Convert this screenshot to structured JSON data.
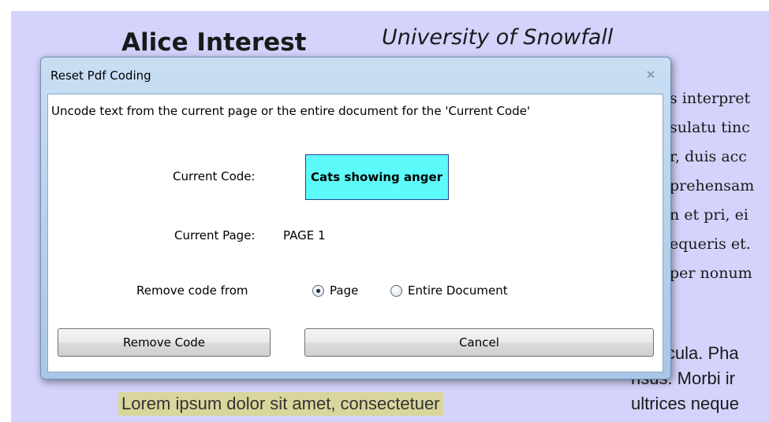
{
  "document": {
    "title": "Alice Interest",
    "affiliation": "University of Snowfall",
    "right_serif_lines": [
      "s interpret",
      "sulatu tinc",
      "r, duis acc",
      "prehensam",
      "n et pri, ei",
      "equeris et.",
      "per nonum"
    ],
    "right_sans_lines": [
      "icula. Pha",
      "risus. Morbi ir",
      "ultrices neque"
    ],
    "highlighted_line": "Lorem ipsum dolor sit amet, consectetuer",
    "highlight_color": "#d9d69c",
    "background_color": "#d4d3fb"
  },
  "dialog": {
    "title": "Reset Pdf Coding",
    "close_icon": "close-icon",
    "description": "Uncode text from the current page or the entire document for the 'Current Code'",
    "current_code_label": "Current Code:",
    "current_code_value": "Cats showing anger",
    "code_highlight_color": "#5cfbf9",
    "current_page_label": "Current Page:",
    "current_page_value": "PAGE 1",
    "remove_from_label": "Remove code from",
    "options": [
      {
        "label": "Page",
        "selected": true
      },
      {
        "label": "Entire Document",
        "selected": false
      }
    ],
    "buttons": {
      "remove": "Remove Code",
      "cancel": "Cancel"
    }
  }
}
